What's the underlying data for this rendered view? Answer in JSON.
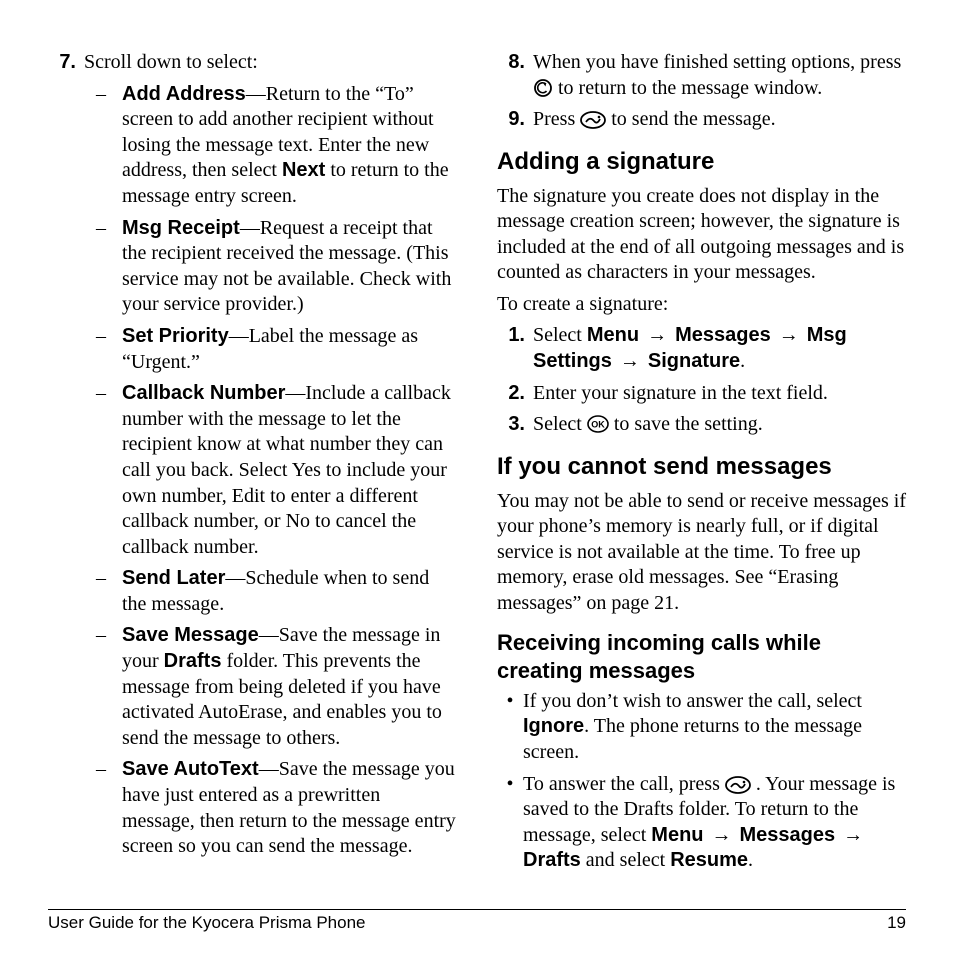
{
  "left": {
    "step7": {
      "num": "7.",
      "lead": "Scroll down to select:",
      "items": [
        {
          "title": "Add Address",
          "text": "—Return to the “To” screen to add another recipient without losing the message text. Enter the new address, then select ",
          "bold2": "Next",
          "tail": " to return to the message entry screen."
        },
        {
          "title": "Msg Receipt",
          "text": "—Request a receipt that the recipient received the message. (This service may not be available. Check with your service provider.)"
        },
        {
          "title": "Set Priority",
          "text": "—Label the message as “Urgent.”"
        },
        {
          "title": "Callback Number",
          "text": "—Include a callback number with the message to let the recipient know at what number they can call you back. Select Yes to include your own number, Edit to enter a different callback number, or No to cancel the callback number."
        },
        {
          "title": "Send Later",
          "text": "—Schedule when to send the message."
        },
        {
          "title": "Save Message",
          "text": "—Save the message in your ",
          "bold2": "Drafts",
          "tail": " folder. This prevents the message from being deleted if you have activated AutoErase, and enables you to send the message to others."
        },
        {
          "title": "Save AutoText",
          "text": "—Save the message you have just entered as a prewritten message, then return to the message entry screen so you can send the message."
        }
      ]
    }
  },
  "right": {
    "step8": {
      "num": "8.",
      "pre": "When you have finished setting options, press ",
      "post": " to return to the message window."
    },
    "step9": {
      "num": "9.",
      "pre": "Press ",
      "post": " to send the message."
    },
    "sig": {
      "heading": "Adding a signature",
      "para": "The signature you create does not display in the message creation screen; however, the signature is included at the end of all outgoing messages and is counted as characters in your messages.",
      "lead": "To create a signature:",
      "s1": {
        "num": "1.",
        "pre": "Select ",
        "m1": "Menu",
        "a": " → ",
        "m2": "Messages",
        "m3": "Msg Settings",
        "m4": "Signature",
        "dot": "."
      },
      "s2": {
        "num": "2.",
        "text": "Enter your signature in the text field."
      },
      "s3": {
        "num": "3.",
        "pre": "Select ",
        "post": " to save the setting."
      }
    },
    "cannot": {
      "heading": "If you cannot send messages",
      "para": "You may not be able to send or receive messages if your phone’s memory is nearly full, or if digital service is not available at the time. To free up memory, erase old messages. See “Erasing messages” on page 21."
    },
    "calls": {
      "heading": "Receiving incoming calls while creating messages",
      "b1": {
        "pre": "If you don’t wish to answer the call, select ",
        "bold": "Ignore",
        "post": ". The phone returns to the message screen."
      },
      "b2": {
        "pre": "To answer the call, press ",
        "mid": " . Your message is saved to the Drafts folder. To return to the message, select ",
        "m1": "Menu",
        "a": " → ",
        "m2": "Messages",
        "m3": "Drafts",
        "post": " and select ",
        "bold": "Resume",
        "dot": "."
      }
    }
  },
  "footer": {
    "title": "User Guide for the Kyocera Prisma Phone",
    "page": "19"
  },
  "glyphs": {
    "dash": "–",
    "bullet": "•"
  }
}
